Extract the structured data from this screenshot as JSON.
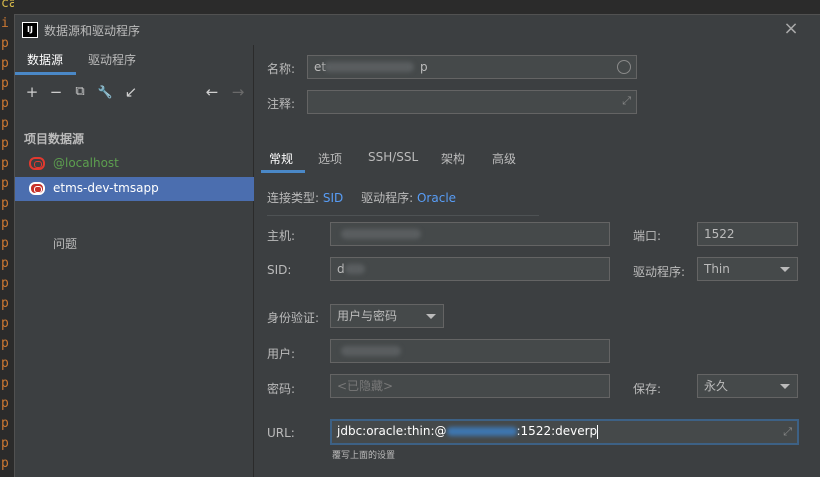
{
  "window": {
    "title": "数据源和驱动程序",
    "app_icon": "IJ",
    "close_icon": "×"
  },
  "editor_bg": {
    "chars": [
      "ca",
      "i",
      "p",
      "p",
      "p",
      "p",
      "p",
      "p",
      "p",
      "p",
      "p",
      "p",
      "p",
      "p",
      "p",
      "p",
      "p",
      "p",
      "p",
      "p",
      "p",
      "p",
      "p",
      "p"
    ]
  },
  "sidebar": {
    "tabs": [
      {
        "label": "数据源",
        "active": true
      },
      {
        "label": "驱动程序",
        "active": false
      }
    ],
    "toolbar": {
      "add": "+",
      "remove": "−",
      "duplicate": "⧉",
      "settings": "🔧",
      "import": "↙",
      "back": "←",
      "forward": "→"
    },
    "section_title": "项目数据源",
    "items": [
      {
        "label": "@localhost",
        "selected": false
      },
      {
        "label": "etms-dev-tmsapp",
        "selected": true
      }
    ],
    "problems_label": "问题"
  },
  "form": {
    "name_label": "名称:",
    "name_value": "et",
    "name_value_tail": "p",
    "comment_label": "注释:",
    "tabs": [
      "常规",
      "选项",
      "SSH/SSL",
      "架构",
      "高级"
    ],
    "conn_type_label": "连接类型:",
    "conn_type_value": "SID",
    "driver_label": "驱动程序:",
    "driver_value": "Oracle",
    "host_label": "主机:",
    "port_label": "端口:",
    "port_value": "1522",
    "sid_label": "SID:",
    "sid_value": "d",
    "driver2_label": "驱动程序:",
    "driver2_value": "Thin",
    "auth_label": "身份验证:",
    "auth_value": "用户与密码",
    "user_label": "用户:",
    "password_label": "密码:",
    "password_placeholder": "<已隐藏>",
    "save_label": "保存:",
    "save_value": "永久",
    "url_label": "URL:",
    "url_prefix": "jdbc:oracle:thin:@",
    "url_suffix": ":1522:deverp",
    "url_hint": "覆写上面的设置"
  },
  "colors": {
    "accent": "#4a88c7",
    "selection": "#4b6eaf",
    "link": "#589df6",
    "oracle_red": "#e2392f",
    "green_text": "#5d9f4f"
  },
  "icons": {
    "oracle": "oracle-db-icon",
    "expand": "expand-icon",
    "circle": "circle-status-icon"
  }
}
